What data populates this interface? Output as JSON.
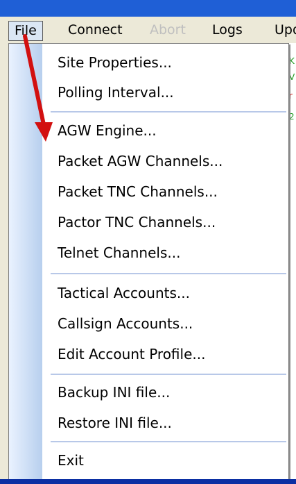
{
  "menubar": {
    "items": [
      "File",
      "Connect",
      "Abort",
      "Logs",
      "Upd"
    ]
  },
  "dropdown": {
    "groups": [
      [
        "Site Properties...",
        "Polling Interval..."
      ],
      [
        "AGW Engine...",
        "Packet AGW Channels...",
        "Packet TNC Channels...",
        "Pactor TNC Channels...",
        "Telnet Channels..."
      ],
      [
        "Tactical Accounts...",
        "Callsign Accounts...",
        "Edit Account Profile..."
      ],
      [
        "Backup INI file...",
        "Restore INI file..."
      ],
      [
        "Exit"
      ]
    ]
  },
  "window_right": {
    "snippets": [
      "K",
      "V",
      "r",
      "2"
    ]
  },
  "colors": {
    "menu_active_bg": "#dbe6f4",
    "arrow": "#d21010"
  }
}
